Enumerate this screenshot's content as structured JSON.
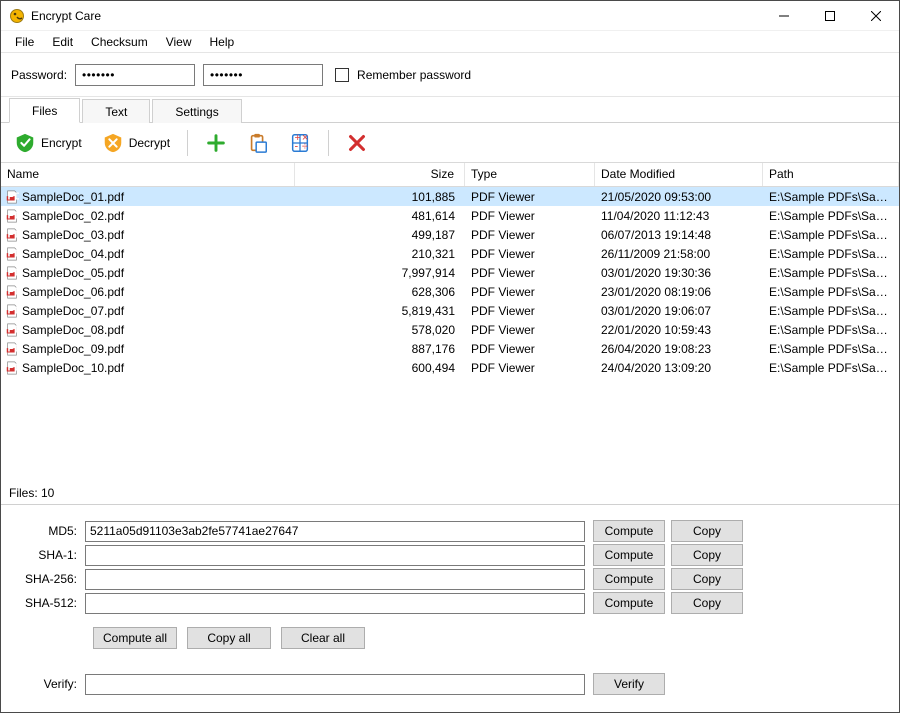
{
  "title": "Encrypt Care",
  "menu": {
    "file": "File",
    "edit": "Edit",
    "checksum": "Checksum",
    "view": "View",
    "help": "Help"
  },
  "password": {
    "label": "Password:",
    "value1": "•••••••",
    "value2": "•••••••",
    "remember_label": "Remember password"
  },
  "tabs": {
    "files": "Files",
    "text": "Text",
    "settings": "Settings"
  },
  "toolbar": {
    "encrypt": "Encrypt",
    "decrypt": "Decrypt"
  },
  "columns": {
    "name": "Name",
    "size": "Size",
    "type": "Type",
    "date": "Date Modified",
    "path": "Path"
  },
  "rows": [
    {
      "name": "SampleDoc_01.pdf",
      "size": "101,885",
      "type": "PDF Viewer",
      "date": "21/05/2020 09:53:00",
      "path": "E:\\Sample PDFs\\Sam...",
      "selected": true
    },
    {
      "name": "SampleDoc_02.pdf",
      "size": "481,614",
      "type": "PDF Viewer",
      "date": "11/04/2020 11:12:43",
      "path": "E:\\Sample PDFs\\Sam..."
    },
    {
      "name": "SampleDoc_03.pdf",
      "size": "499,187",
      "type": "PDF Viewer",
      "date": "06/07/2013 19:14:48",
      "path": "E:\\Sample PDFs\\Sam..."
    },
    {
      "name": "SampleDoc_04.pdf",
      "size": "210,321",
      "type": "PDF Viewer",
      "date": "26/11/2009 21:58:00",
      "path": "E:\\Sample PDFs\\Sam..."
    },
    {
      "name": "SampleDoc_05.pdf",
      "size": "7,997,914",
      "type": "PDF Viewer",
      "date": "03/01/2020 19:30:36",
      "path": "E:\\Sample PDFs\\Sam..."
    },
    {
      "name": "SampleDoc_06.pdf",
      "size": "628,306",
      "type": "PDF Viewer",
      "date": "23/01/2020 08:19:06",
      "path": "E:\\Sample PDFs\\Sam..."
    },
    {
      "name": "SampleDoc_07.pdf",
      "size": "5,819,431",
      "type": "PDF Viewer",
      "date": "03/01/2020 19:06:07",
      "path": "E:\\Sample PDFs\\Sam..."
    },
    {
      "name": "SampleDoc_08.pdf",
      "size": "578,020",
      "type": "PDF Viewer",
      "date": "22/01/2020 10:59:43",
      "path": "E:\\Sample PDFs\\Sam..."
    },
    {
      "name": "SampleDoc_09.pdf",
      "size": "887,176",
      "type": "PDF Viewer",
      "date": "26/04/2020 19:08:23",
      "path": "E:\\Sample PDFs\\Sam..."
    },
    {
      "name": "SampleDoc_10.pdf",
      "size": "600,494",
      "type": "PDF Viewer",
      "date": "24/04/2020 13:09:20",
      "path": "E:\\Sample PDFs\\Sam..."
    }
  ],
  "status": "Files: 10",
  "hash": {
    "md5_label": "MD5:",
    "md5_value": "5211a05d91103e3ab2fe57741ae27647",
    "sha1_label": "SHA-1:",
    "sha1_value": "",
    "sha256_label": "SHA-256:",
    "sha256_value": "",
    "sha512_label": "SHA-512:",
    "sha512_value": "",
    "compute": "Compute",
    "copy": "Copy",
    "compute_all": "Compute all",
    "copy_all": "Copy all",
    "clear_all": "Clear all",
    "verify_label": "Verify:",
    "verify_value": "",
    "verify_btn": "Verify"
  }
}
